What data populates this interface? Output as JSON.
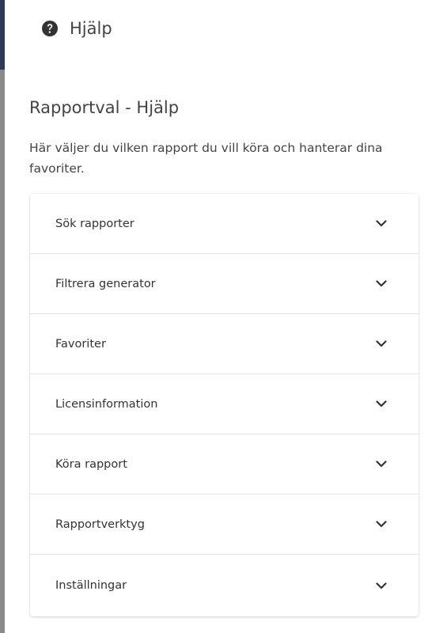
{
  "header": {
    "icon": "question-circle-icon",
    "title": "Hjälp"
  },
  "section": {
    "title": "Rapportval - Hjälp",
    "description": "Här väljer du vilken rapport du vill köra och hanterar dina favoriter."
  },
  "accordion": {
    "items": [
      {
        "label": "Sök rapporter",
        "icon": "chevron-down-icon"
      },
      {
        "label": "Filtrera generator",
        "icon": "chevron-down-icon"
      },
      {
        "label": "Favoriter",
        "icon": "chevron-down-icon"
      },
      {
        "label": "Licensinformation",
        "icon": "chevron-down-icon"
      },
      {
        "label": "Köra rapport",
        "icon": "chevron-down-icon"
      },
      {
        "label": "Rapportverktyg",
        "icon": "chevron-down-icon"
      },
      {
        "label": "Inställningar",
        "icon": "chevron-down-icon"
      }
    ]
  },
  "colors": {
    "edge_bar": "#8a8a8a",
    "edge_bar_accent": "#2f3b55",
    "text": "#333333"
  }
}
